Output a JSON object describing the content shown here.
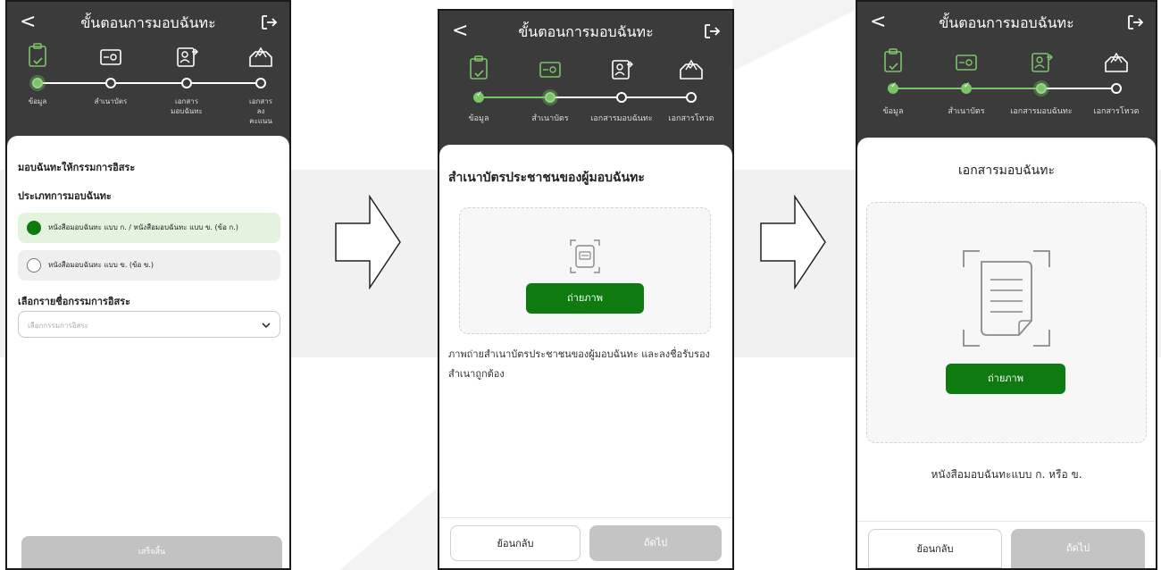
{
  "app": {
    "title": "ขั้นตอนการมอบฉันทะ",
    "back_icon": "chevron-left-icon",
    "exit_icon": "logout-icon"
  },
  "colors": {
    "header_bg": "#3b3b3b",
    "accent_green": "#0f7a10",
    "step_done": "#7cc46a",
    "disabled": "#c4c4c4"
  },
  "screen1": {
    "step_labels": [
      "ข้อมูล",
      "สำเนาบัตร",
      "เอกสาร\nมอบฉันทะ",
      "เอกสารลง\nคะแนน"
    ],
    "section_title": "มอบฉันทะให้กรรมการอิสระ",
    "type_title": "ประเภทการมอบฉันทะ",
    "option_a": "หนังสือมอบฉันทะ แบบ ก. / หนังสือมอบฉันทะ แบบ ข. (ข้อ ก.)",
    "option_b": "หนังสือมอบฉันทะ แบบ ข. (ข้อ ข.)",
    "director_title": "เลือกรายชื่อกรรมการอิสระ",
    "director_placeholder": "เลือกกรรมการอิสระ",
    "finish_button": "เสร็จสิ้น"
  },
  "screen2": {
    "step_labels": [
      "ข้อมูล",
      "สำเนาบัตร",
      "เอกสารมอบฉันทะ",
      "เอกสารโหวต"
    ],
    "section_title": "สำเนาบัตรประชาชนของผู้มอบฉันทะ",
    "photo_button": "ถ่ายภาพ",
    "description": "ภาพถ่ายสำเนาบัตรประชาชนของผู้มอบฉันทะ และลงชื่อรับรองสำเนาถูกต้อง",
    "back_button": "ย้อนกลับ",
    "next_button": "ถัดไป"
  },
  "screen3": {
    "step_labels": [
      "ข้อมูล",
      "สำเนาบัตร",
      "เอกสารมอบฉันทะ",
      "เอกสารโหวต"
    ],
    "section_title": "เอกสารมอบฉันทะ",
    "photo_button": "ถ่ายภาพ",
    "caption": "หนังสือมอบฉันทะแบบ ก. หรือ ข.",
    "back_button": "ย้อนกลับ",
    "next_button": "ถัดไป"
  }
}
